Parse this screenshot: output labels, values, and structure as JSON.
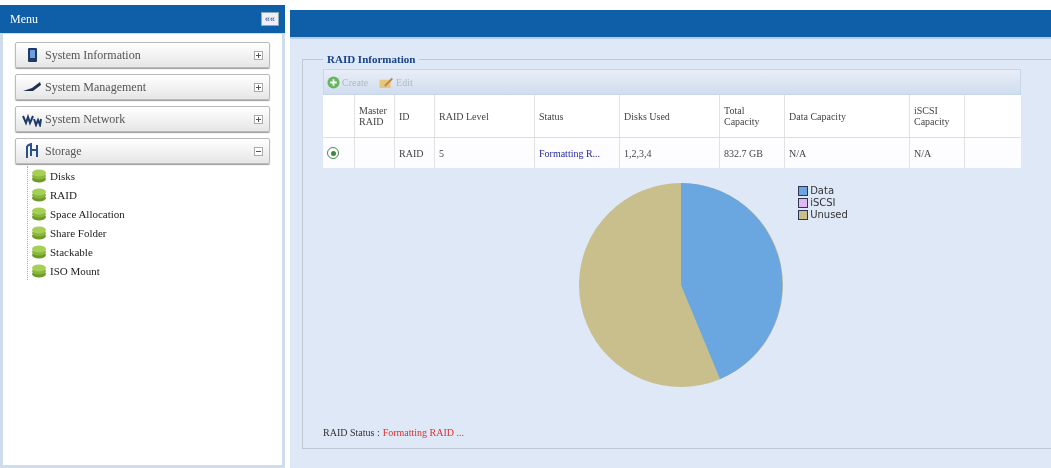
{
  "sidebar": {
    "title": "Menu",
    "collapse_label": "««",
    "sections": [
      {
        "label": "System Information",
        "expanded": false
      },
      {
        "label": "System Management",
        "expanded": false
      },
      {
        "label": "System Network",
        "expanded": false
      },
      {
        "label": "Storage",
        "expanded": true,
        "children": [
          {
            "label": "Disks"
          },
          {
            "label": "RAID"
          },
          {
            "label": "Space Allocation"
          },
          {
            "label": "Share Folder"
          },
          {
            "label": "Stackable"
          },
          {
            "label": "ISO Mount"
          }
        ]
      }
    ]
  },
  "panel": {
    "legend": "RAID Information",
    "toolbar": [
      {
        "label": "Create",
        "disabled": true
      },
      {
        "label": "Edit",
        "disabled": true
      }
    ],
    "table": {
      "columns": [
        "Master RAID",
        "ID",
        "RAID Level",
        "Status",
        "Disks Used",
        "Total Capacity",
        "Data Capacity",
        "iSCSI Capacity"
      ],
      "rows": [
        {
          "selected": true,
          "cells": [
            "",
            "RAID",
            "5",
            "Formatting R...",
            "1,2,3,4",
            "832.7 GB",
            "N/A",
            "N/A"
          ]
        }
      ]
    },
    "chart_legend": [
      {
        "label": "Data",
        "color": "#6aa6e0"
      },
      {
        "label": "iSCSI",
        "color": "#e0b8f0"
      },
      {
        "label": "Unused",
        "color": "#c8bf8c"
      }
    ],
    "status_label": "RAID Status :",
    "status_value": "Formatting RAID ..."
  }
}
